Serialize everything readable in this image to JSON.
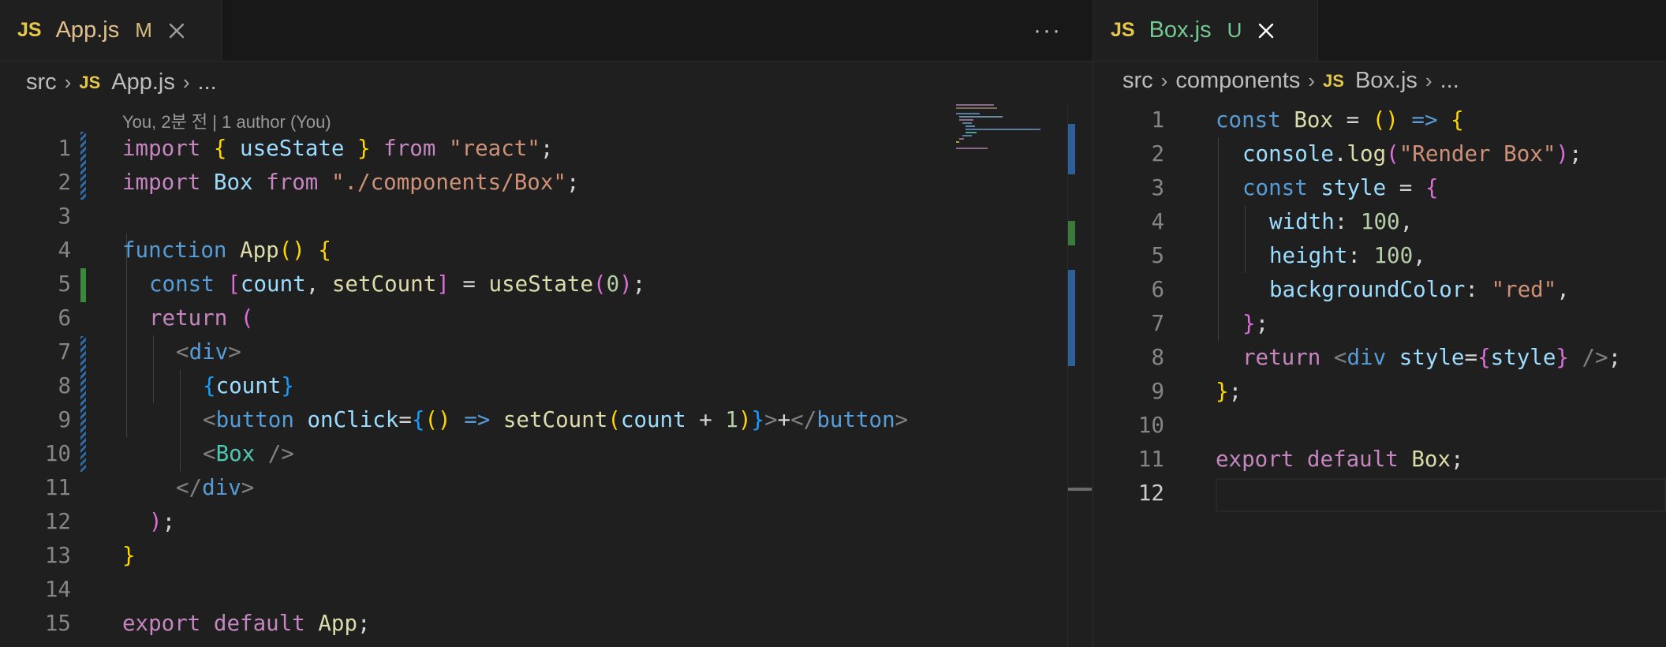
{
  "left_editor": {
    "tab": {
      "icon": "JS",
      "filename": "App.js",
      "status": "M"
    },
    "more_actions_label": "···",
    "breadcrumb": {
      "folder": "src",
      "icon": "JS",
      "file": "App.js",
      "symbol": "..."
    },
    "codelens": "You, 2분 전 | 1 author (You)",
    "line_numbers": [
      "1",
      "2",
      "3",
      "4",
      "5",
      "6",
      "7",
      "8",
      "9",
      "10",
      "11",
      "12",
      "13",
      "14",
      "15"
    ]
  },
  "right_editor": {
    "tab": {
      "icon": "JS",
      "filename": "Box.js",
      "status": "U"
    },
    "breadcrumb": {
      "folder": "src",
      "subfolder": "components",
      "icon": "JS",
      "file": "Box.js",
      "symbol": "..."
    },
    "line_numbers": [
      "1",
      "2",
      "3",
      "4",
      "5",
      "6",
      "7",
      "8",
      "9",
      "10",
      "11",
      "12"
    ],
    "active_line": "12"
  },
  "colors": {
    "keyword": "#c586c0",
    "storage": "#569cd6",
    "function": "#dcdcaa",
    "variable": "#9cdcfe",
    "string": "#ce9178",
    "number": "#b5cea8",
    "component": "#4ec9b0",
    "js_icon": "#e6c84a",
    "modified_status": "#d7ba7d",
    "untracked_status": "#73c991"
  }
}
